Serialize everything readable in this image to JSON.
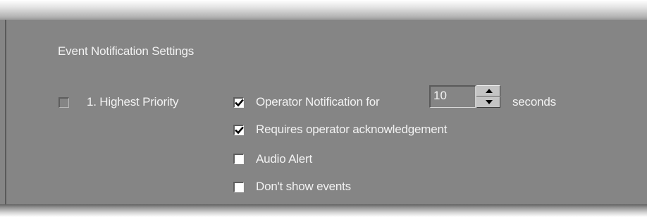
{
  "section": {
    "title": "Event Notification Settings"
  },
  "priority": {
    "label": "1. Highest Priority",
    "checked": false,
    "enabled": false
  },
  "options": {
    "operator_notification": {
      "label": "Operator Notification for",
      "checked": true
    },
    "duration": {
      "value": "10",
      "unit_label": "seconds"
    },
    "requires_ack": {
      "label": "Requires operator acknowledgement",
      "checked": true
    },
    "audio_alert": {
      "label": "Audio Alert",
      "checked": false
    },
    "dont_show": {
      "label": "Don't show events",
      "checked": false
    }
  },
  "icons": {
    "check": "checkmark-icon",
    "spin_up": "up-arrow-icon",
    "spin_down": "down-arrow-icon"
  },
  "colors": {
    "panel_bg": "#858585",
    "text": "#f2f2f2",
    "checkbox_bg": "#ffffff"
  }
}
